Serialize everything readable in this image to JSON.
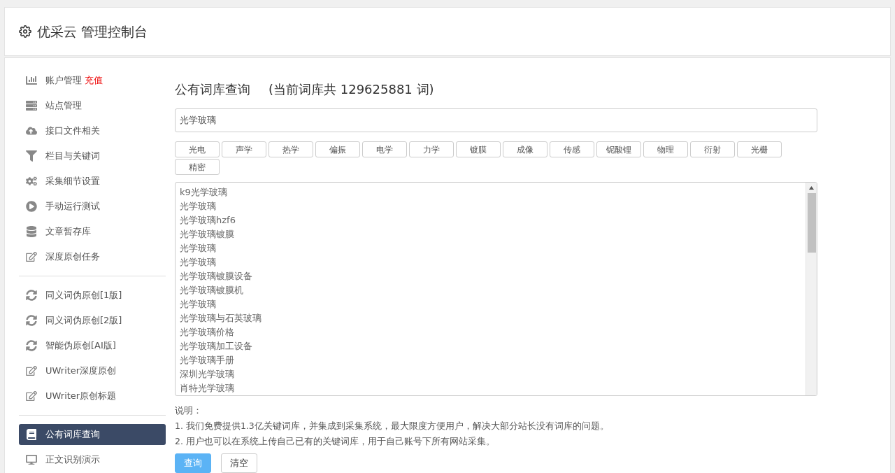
{
  "header": {
    "title": "优采云 管理控制台"
  },
  "sidebar": {
    "groups": [
      {
        "items": [
          {
            "label": "账户管理",
            "badge": "充值",
            "selected": false
          },
          {
            "label": "站点管理",
            "selected": false
          },
          {
            "label": "接口文件相关",
            "selected": false
          },
          {
            "label": "栏目与关键词",
            "selected": false
          },
          {
            "label": "采集细节设置",
            "selected": false
          },
          {
            "label": "手动运行测试",
            "selected": false
          },
          {
            "label": "文章暂存库",
            "selected": false
          },
          {
            "label": "深度原创任务",
            "selected": false
          }
        ]
      },
      {
        "items": [
          {
            "label": "同义词伪原创[1版]",
            "selected": false
          },
          {
            "label": "同义词伪原创[2版]",
            "selected": false
          },
          {
            "label": "智能伪原创[AI版]",
            "selected": false
          },
          {
            "label": "UWriter深度原创",
            "selected": false
          },
          {
            "label": "UWriter原创标题",
            "selected": false
          }
        ]
      },
      {
        "items": [
          {
            "label": "公有词库查询",
            "selected": true
          },
          {
            "label": "正文识别演示",
            "selected": false
          }
        ]
      }
    ]
  },
  "main": {
    "title": "公有词库查询",
    "subtitle": "(当前词库共 129625881 词)",
    "search": {
      "value": "光学玻璃"
    },
    "tags": [
      "光电",
      "声学",
      "热学",
      "偏振",
      "电学",
      "力学",
      "镀膜",
      "成像",
      "传感",
      "铌酸锂",
      "物理",
      "衍射",
      "光栅",
      "精密"
    ],
    "results": [
      "k9光学玻璃",
      "光学玻璃",
      "光学玻璃hzf6",
      "光学玻璃镀膜",
      "光学玻璃",
      "光学玻璃",
      "光学玻璃镀膜设备",
      "光学玻璃镀膜机",
      "光学玻璃",
      "光学玻璃与石英玻璃",
      "光学玻璃价格",
      "光学玻璃加工设备",
      "光学玻璃手册",
      "深圳光学玻璃",
      "肖特光学玻璃"
    ],
    "notes_title": "说明：",
    "notes": [
      "1. 我们免费提供1.3亿关键词库，并集成到采集系统，最大限度方便用户，解决大部分站长没有词库的问题。",
      "2. 用户也可以在系统上传自己已有的关键词库，用于自己账号下所有网站采集。"
    ],
    "buttons": [
      {
        "label": "查询",
        "kind": "primary"
      },
      {
        "label": "清空",
        "kind": "default"
      }
    ]
  }
}
